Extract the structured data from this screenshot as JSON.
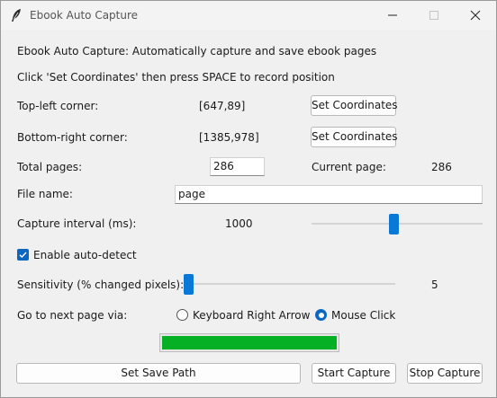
{
  "window": {
    "title": "Ebook Auto Capture"
  },
  "header": {
    "description": "Ebook Auto Capture: Automatically capture and save ebook pages",
    "instructions": "Click 'Set Coordinates' then press SPACE to record position"
  },
  "coordinates": {
    "top_left_label": "Top-left corner:",
    "top_left_value": "[647,89]",
    "bottom_right_label": "Bottom-right corner:",
    "bottom_right_value": "[1385,978]",
    "set_button_label": "Set Coordinates"
  },
  "pages": {
    "total_label": "Total pages:",
    "total_value": "286",
    "current_label": "Current page:",
    "current_value": "286"
  },
  "file": {
    "label": "File name:",
    "value": "page"
  },
  "interval": {
    "label": "Capture interval (ms):",
    "value": "1000",
    "slider_fraction": 0.48
  },
  "auto_detect": {
    "label": "Enable auto-detect",
    "checked": true
  },
  "sensitivity": {
    "label": "Sensitivity (% changed pixels):",
    "value": "5",
    "slider_fraction": 0.0
  },
  "navigation": {
    "label": "Go to next page via:",
    "options": [
      {
        "label": "Keyboard Right Arrow",
        "selected": false
      },
      {
        "label": "Mouse Click",
        "selected": true
      }
    ]
  },
  "progress": {
    "fraction": 1.0
  },
  "buttons": {
    "save_path": "Set Save Path",
    "start_capture": "Start Capture",
    "stop_capture": "Stop Capture"
  },
  "colors": {
    "accent": "#0a78d7",
    "progress_fill": "#06b025"
  }
}
